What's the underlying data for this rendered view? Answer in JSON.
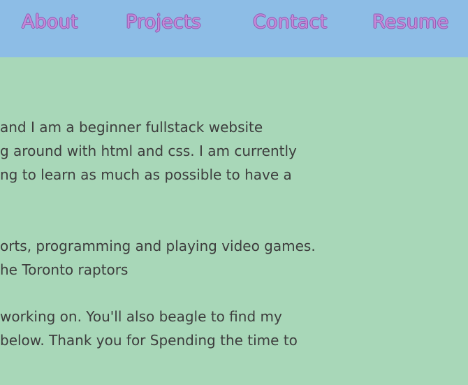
{
  "nav": {
    "about": "About",
    "projects": "Projects",
    "contact": "Contact",
    "resume": "Resume"
  },
  "content": {
    "paragraph1": {
      "line1": " and I am a beginner fullstack website",
      "line2": "g around with html and css. I am currently",
      "line3": "ng to learn as much as possible to have a"
    },
    "paragraph2": {
      "line1": "orts, programming and playing video games.",
      "line2": "he Toronto raptors"
    },
    "paragraph3": {
      "line1": "working on. You'll also beagle to find my",
      "line2": "below. Thank you for Spending the time to"
    }
  },
  "colors": {
    "page_background": "#a8d7b8",
    "header_background": "#8dbde6",
    "nav_text": "#c48ad8",
    "body_text": "#3d3d3d"
  }
}
